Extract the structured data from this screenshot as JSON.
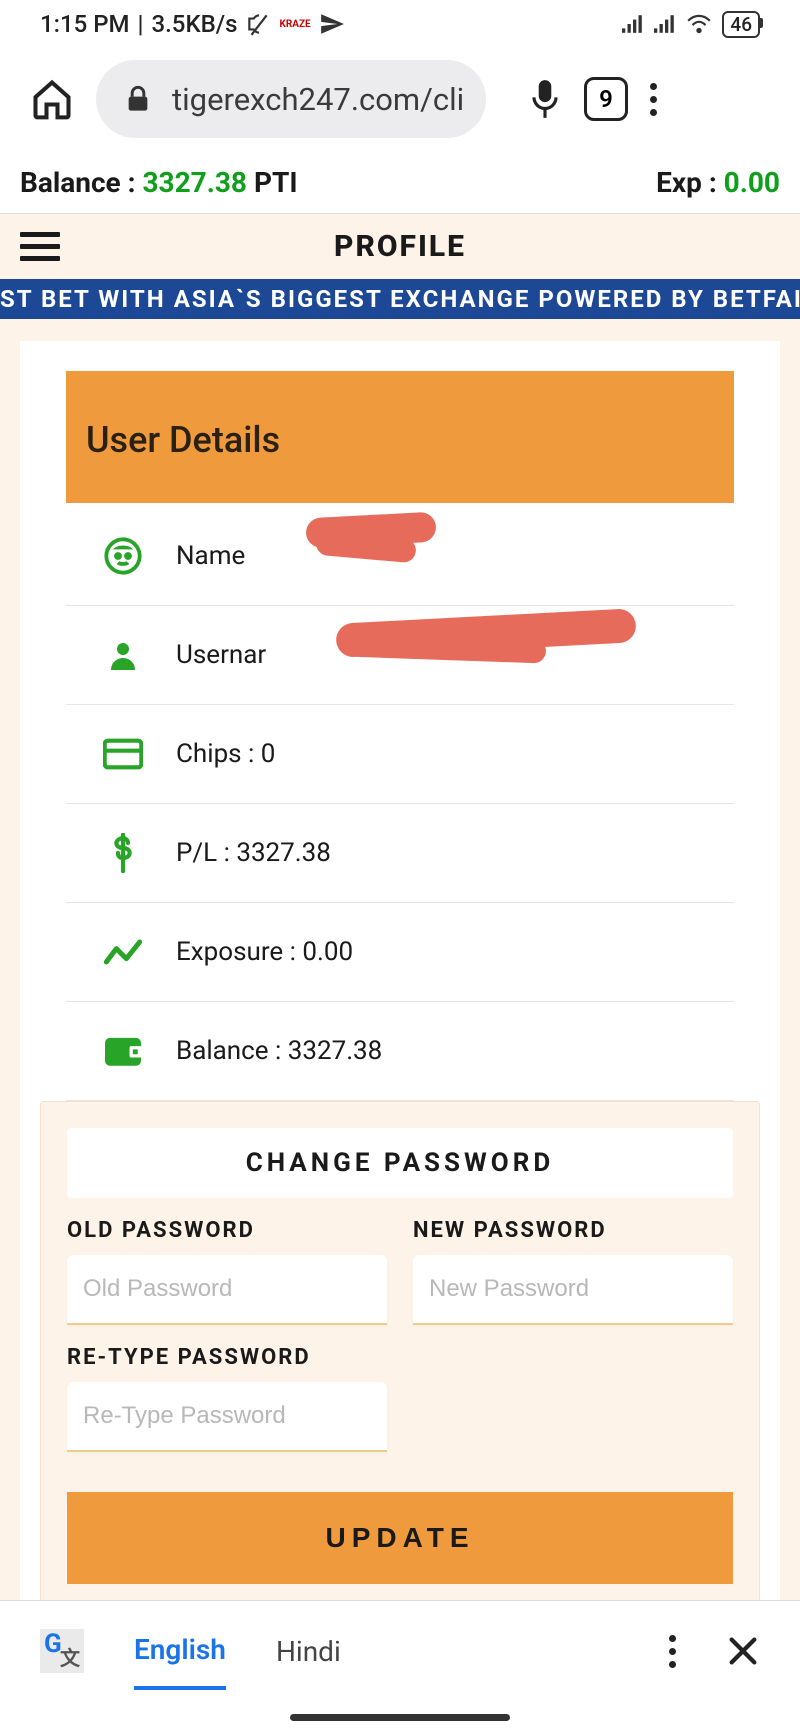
{
  "status": {
    "time": "1:15 PM",
    "net_speed": "3.5KB/s",
    "battery": "46"
  },
  "browser": {
    "url": "tigerexch247.com/cli",
    "tab_count": "9"
  },
  "balance_bar": {
    "balance_label": "Balance :",
    "balance_value": "3327.38",
    "balance_unit": "PTI",
    "exp_label": "Exp :",
    "exp_value": "0.00"
  },
  "header": {
    "title": "PROFILE"
  },
  "marquee": "ST BET WITH ASIA`S BIGGEST EXCHANGE POWERED BY BETFAIR (",
  "details": {
    "banner_title": "User Details",
    "rows": {
      "name_label": "Name",
      "username_label": "Usernar",
      "chips": "Chips : 0",
      "pl": "P/L : 3327.38",
      "exposure": "Exposure : 0.00",
      "balance": "Balance : 3327.38"
    }
  },
  "change_password": {
    "title": "CHANGE PASSWORD",
    "old_label": "OLD PASSWORD",
    "old_placeholder": "Old Password",
    "new_label": "NEW PASSWORD",
    "new_placeholder": "New Password",
    "retype_label": "RE-TYPE PASSWORD",
    "retype_placeholder": "Re-Type Password",
    "button": "UPDATE"
  },
  "translate": {
    "active": "English",
    "other": "Hindi"
  }
}
